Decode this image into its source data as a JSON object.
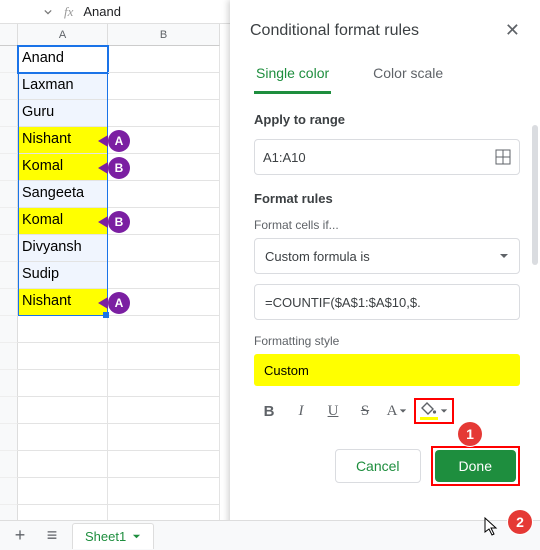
{
  "fx": {
    "namebox_caret": "▾",
    "label": "fx",
    "value": "Anand"
  },
  "columns": [
    "A",
    "B"
  ],
  "cells": [
    {
      "value": "Anand",
      "hl": false,
      "pill": null,
      "active": true
    },
    {
      "value": "Laxman",
      "hl": false,
      "pill": null
    },
    {
      "value": "Guru",
      "hl": false,
      "pill": null
    },
    {
      "value": "Nishant",
      "hl": true,
      "pill": "A"
    },
    {
      "value": "Komal",
      "hl": true,
      "pill": "B"
    },
    {
      "value": "Sangeeta",
      "hl": false,
      "pill": null
    },
    {
      "value": "Komal",
      "hl": true,
      "pill": "B"
    },
    {
      "value": "Divyansh",
      "hl": false,
      "pill": null
    },
    {
      "value": "Sudip",
      "hl": false,
      "pill": null
    },
    {
      "value": "Nishant",
      "hl": true,
      "pill": "A"
    }
  ],
  "extra_rows": 8,
  "panel": {
    "title": "Conditional format rules",
    "tabs": {
      "single": "Single color",
      "scale": "Color scale"
    },
    "apply_label": "Apply to range",
    "range": "A1:A10",
    "rules_label": "Format rules",
    "cells_if": "Format cells if...",
    "condition": "Custom formula is",
    "formula": "=COUNTIF($A$1:$A$10,$.",
    "style_label": "Formatting style",
    "preview": "Custom",
    "fmt": {
      "b": "B",
      "i": "I",
      "u": "U",
      "s": "S",
      "a": "A"
    },
    "cancel": "Cancel",
    "done": "Done",
    "anno1": "1",
    "anno2": "2"
  },
  "sheets": {
    "plus": "+",
    "menu": "≡",
    "name": "Sheet1"
  }
}
